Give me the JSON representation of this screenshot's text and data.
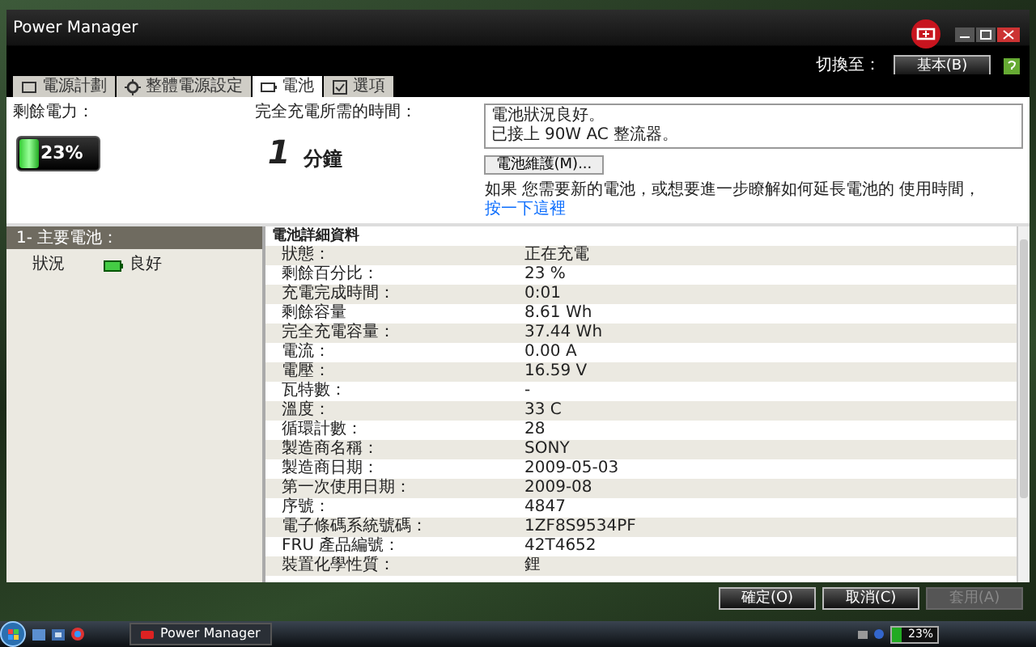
{
  "window": {
    "title": "Power Manager"
  },
  "header": {
    "switch_label": "切換至：",
    "switch_button": "基本(B)"
  },
  "tabs": [
    {
      "label": "電源計劃",
      "kind": "plan",
      "selected": false
    },
    {
      "label": "整體電源設定",
      "kind": "settings",
      "selected": false
    },
    {
      "label": "電池",
      "kind": "battery",
      "selected": true
    },
    {
      "label": "選項",
      "kind": "options",
      "selected": false
    }
  ],
  "battery_summary": {
    "label": "剩餘電力：",
    "reading": "23%",
    "level": 0.23
  },
  "charge_time": {
    "label": "完全充電所需的時間：",
    "value": "1",
    "unit": "分鐘"
  },
  "status_messages": [
    "電池狀況良好。",
    "已接上 90W AC 整流器。"
  ],
  "maintenance_button": "電池維護(M)...",
  "info": {
    "text": "如果 您需要新的電池，或想要進一步瞭解如何延長電池的 使用時間，",
    "link": "按一下這裡"
  },
  "batteries": [
    {
      "label": "1- 主要電池：",
      "status_label": "狀況",
      "status": "良好"
    }
  ],
  "details": {
    "title": "電池詳細資料",
    "rows": [
      {
        "label": "狀態：",
        "value": "正在充電"
      },
      {
        "label": "剩餘百分比：",
        "value": "23 %"
      },
      {
        "label": "充電完成時間：",
        "value": "0:01"
      },
      {
        "label": "剩餘容量",
        "value": "8.61 Wh"
      },
      {
        "label": "完全充電容量：",
        "value": "37.44 Wh"
      },
      {
        "label": "電流：",
        "value": "0.00 A"
      },
      {
        "label": "電壓：",
        "value": "16.59 V"
      },
      {
        "label": "瓦特數：",
        "value": "-"
      },
      {
        "label": "溫度：",
        "value": "33 C"
      },
      {
        "label": "循環計數：",
        "value": "28"
      },
      {
        "label": "製造商名稱：",
        "value": "SONY"
      },
      {
        "label": "製造商日期：",
        "value": "2009-05-03"
      },
      {
        "label": "第一次使用日期：",
        "value": "2009-08"
      },
      {
        "label": "序號：",
        "value": "4847"
      },
      {
        "label": "電子條碼系統號碼：",
        "value": "1ZF8S9534PF"
      },
      {
        "label": "FRU 產品編號：",
        "value": "42T4652"
      },
      {
        "label": "裝置化學性質：",
        "value": "鋰"
      }
    ]
  },
  "buttons": [
    {
      "label": "確定(O)",
      "disabled": false
    },
    {
      "label": "取消(C)",
      "disabled": false
    },
    {
      "label": "套用(A)",
      "disabled": true
    }
  ],
  "taskbar": {
    "app": "Power Manager",
    "tray_battery": {
      "reading": "23%",
      "level": 0.23
    }
  }
}
